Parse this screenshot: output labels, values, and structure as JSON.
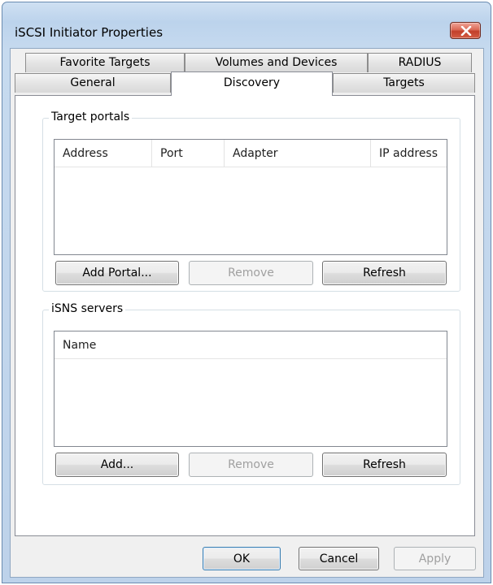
{
  "window": {
    "title": "iSCSI Initiator Properties",
    "close_icon": "close-x-icon"
  },
  "tabs": {
    "row1": [
      "Favorite Targets",
      "Volumes and Devices",
      "RADIUS"
    ],
    "row2": [
      "General",
      "Discovery",
      "Targets"
    ],
    "active": "Discovery"
  },
  "target_portals": {
    "legend": "Target portals",
    "columns": [
      "Address",
      "Port",
      "Adapter",
      "IP address"
    ],
    "rows": [],
    "buttons": {
      "add": "Add Portal...",
      "remove": "Remove",
      "refresh": "Refresh"
    }
  },
  "isns_servers": {
    "legend": "iSNS servers",
    "columns": [
      "Name"
    ],
    "rows": [],
    "buttons": {
      "add": "Add...",
      "remove": "Remove",
      "refresh": "Refresh"
    }
  },
  "dialog_buttons": {
    "ok": "OK",
    "cancel": "Cancel",
    "apply": "Apply"
  },
  "colors": {
    "frame": "#bcd3ec",
    "close_button": "#c2402b",
    "disabled_text": "#a0a0a0"
  }
}
